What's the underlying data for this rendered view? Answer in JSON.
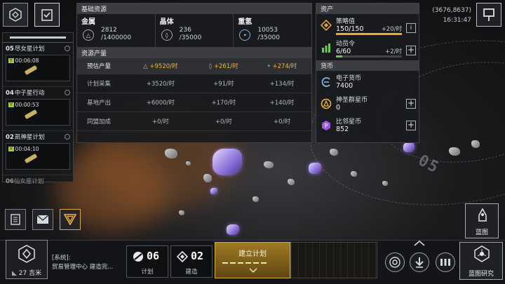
{
  "basic_resources": {
    "header": "基础资源",
    "metal": {
      "name": "金属",
      "current": "2812",
      "cap": "/1400000"
    },
    "crystal": {
      "name": "晶体",
      "current": "236",
      "cap": "/35000"
    },
    "deuterium": {
      "name": "重氢",
      "current": "10053",
      "cap": "/35000"
    }
  },
  "production": {
    "header": "资源产量",
    "rows": [
      {
        "label": "预估产量",
        "metal": "+9520/时",
        "crystal": "+261/时",
        "deuterium": "+274/时"
      },
      {
        "label": "计划采集",
        "metal": "+3520/时",
        "crystal": "+91/时",
        "deuterium": "+134/时"
      },
      {
        "label": "基地产出",
        "metal": "+6000/时",
        "crystal": "+170/时",
        "deuterium": "+140/时"
      },
      {
        "label": "同盟加成",
        "metal": "+0/时",
        "crystal": "+0/时",
        "deuterium": "+0/时"
      }
    ]
  },
  "assets": {
    "header": "资产",
    "strategy": {
      "name": "策略值",
      "value": "150/150",
      "rate": "+20/时",
      "progress": 1.0
    },
    "mobilize": {
      "name": "动员令",
      "value": "6/60",
      "rate": "+2/时",
      "progress": 0.1
    },
    "currency_header": "货币",
    "currencies": [
      {
        "name": "电子货币",
        "value": "7400"
      },
      {
        "name": "神圣群星币",
        "value": "0"
      },
      {
        "name": "比邻星币",
        "value": "852"
      }
    ]
  },
  "coords": {
    "position": "(3676,8637)",
    "time": "16:31:47"
  },
  "missions": [
    {
      "num": "05",
      "name": "尽女星计划",
      "time": "00:06:08"
    },
    {
      "num": "04",
      "name": "中子星行动",
      "time": "00:00:53"
    },
    {
      "num": "02",
      "name": "凯神星计划",
      "time": "00:04:10"
    },
    {
      "num": "06",
      "name": "仙女座计划"
    }
  ],
  "map_zone_label": "05",
  "bottom": {
    "distance": "27 吉米",
    "system_tag": "[系统]:",
    "system_msg": "贸易管理中心 建造完...",
    "plan_count": "06",
    "plan_label": "计划",
    "build_count": "02",
    "build_label": "建造",
    "build_plan": "建立计划",
    "blueprint_label": "蓝图",
    "blueprint_research": "蓝图研究"
  },
  "colors": {
    "accent": "#f0a830",
    "green": "#6ec85a",
    "panel": "#1a1b1e"
  }
}
